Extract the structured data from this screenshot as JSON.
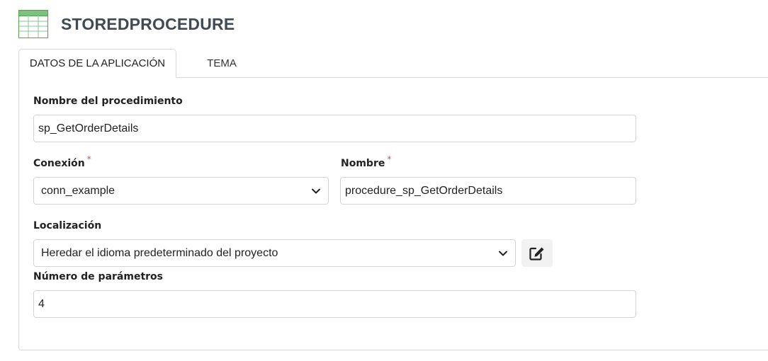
{
  "header": {
    "title": "STOREDPROCEDURE",
    "icon": "table-icon"
  },
  "tabs": [
    {
      "label": "DATOS DE LA APLICACIÓN",
      "active": true
    },
    {
      "label": "TEMA",
      "active": false
    }
  ],
  "form": {
    "procedure_name": {
      "label": "Nombre del procedimiento",
      "value": "sp_GetOrderDetails"
    },
    "connection": {
      "label": "Conexión",
      "required_mark": "*",
      "value": "conn_example"
    },
    "name": {
      "label": "Nombre",
      "required_mark": "*",
      "value": "procedure_sp_GetOrderDetails"
    },
    "localization": {
      "label": "Localización",
      "value": "Heredar el idioma predeterminado del proyecto"
    },
    "param_count": {
      "label": "Número de parámetros",
      "value": "4"
    }
  },
  "colors": {
    "required": "#d9534f",
    "title": "#414a54",
    "border": "#d9d9d9",
    "icon_green": "#4a9a4a"
  }
}
